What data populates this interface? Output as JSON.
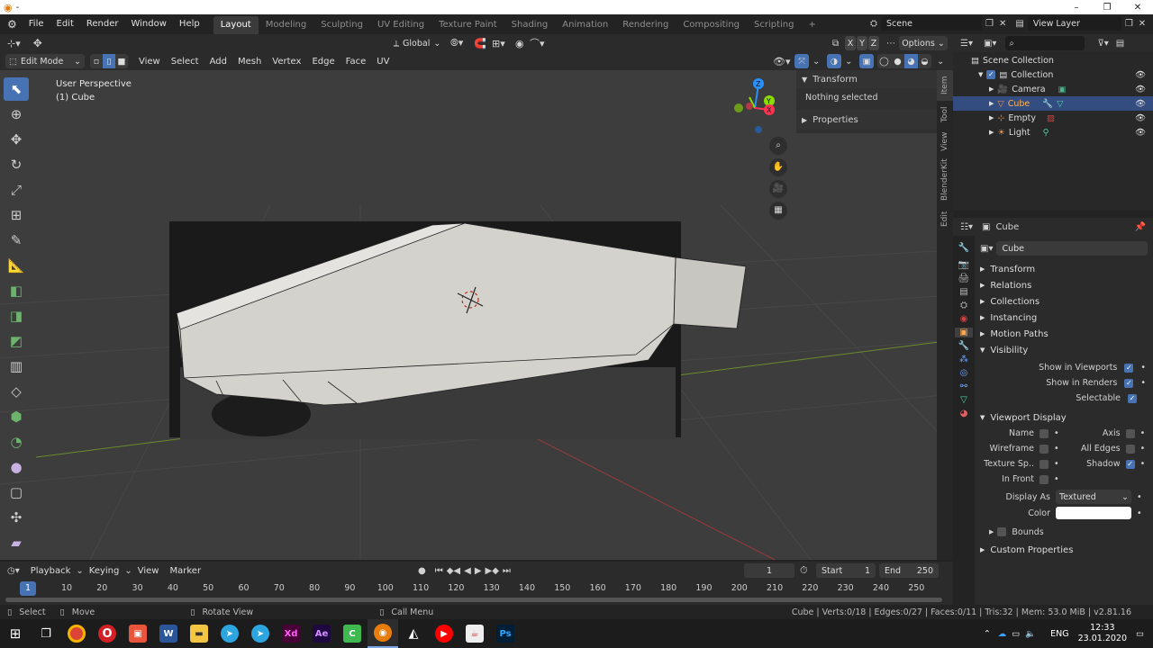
{
  "titlebar": {
    "title": "-",
    "min": "–",
    "max": "❐",
    "close": "✕"
  },
  "menu": {
    "items": [
      "File",
      "Edit",
      "Render",
      "Window",
      "Help"
    ]
  },
  "workspaces": {
    "tabs": [
      "Layout",
      "Modeling",
      "Sculpting",
      "UV Editing",
      "Texture Paint",
      "Shading",
      "Animation",
      "Rendering",
      "Compositing",
      "Scripting"
    ],
    "add": "+"
  },
  "scene": {
    "label": "Scene",
    "view_layer": "View Layer"
  },
  "viewport": {
    "transform_orientation": "Global",
    "options": "Options",
    "axis_x": "X",
    "axis_y": "Y",
    "axis_z": "Z",
    "mode": "Edit Mode",
    "header_menus": [
      "View",
      "Select",
      "Add",
      "Mesh",
      "Vertex",
      "Edge",
      "Face",
      "UV"
    ],
    "perspective": "User Perspective",
    "object": "(1) Cube",
    "gizmo": {
      "z": "Z",
      "y": "Y",
      "x": "X"
    }
  },
  "npanel": {
    "transform": "Transform",
    "nothing_selected": "Nothing selected",
    "properties": "Properties",
    "tabs": [
      "Item",
      "Tool",
      "View",
      "BlenderKit",
      "Edit"
    ]
  },
  "outliner": {
    "root": "Scene Collection",
    "collection": "Collection",
    "items": [
      "Camera",
      "Cube",
      "Empty",
      "Light"
    ]
  },
  "properties": {
    "object_name": "Cube",
    "field_name": "Cube",
    "sections": [
      "Transform",
      "Relations",
      "Collections",
      "Instancing",
      "Motion Paths"
    ],
    "visibility": {
      "title": "Visibility",
      "show_viewports": "Show in Viewports",
      "show_renders": "Show in Renders",
      "selectable": "Selectable"
    },
    "viewport_display": {
      "title": "Viewport Display",
      "name": "Name",
      "axis": "Axis",
      "wireframe": "Wireframe",
      "all_edges": "All Edges",
      "texture_space": "Texture Sp..",
      "shadow": "Shadow",
      "in_front": "In Front",
      "display_as_label": "Display As",
      "display_as_value": "Textured",
      "color_label": "Color",
      "bounds": "Bounds"
    },
    "custom_properties": "Custom Properties"
  },
  "timeline": {
    "menus": [
      "Playback",
      "Keying",
      "View",
      "Marker"
    ],
    "current_frame": "1",
    "start_label": "Start",
    "start": "1",
    "end_label": "End",
    "end": "250",
    "ruler": [
      "1",
      "10",
      "20",
      "30",
      "40",
      "50",
      "60",
      "70",
      "80",
      "90",
      "100",
      "110",
      "120",
      "130",
      "140",
      "150",
      "160",
      "170",
      "180",
      "190",
      "200",
      "210",
      "220",
      "230",
      "240",
      "250"
    ]
  },
  "statusbar": {
    "select": "Select",
    "move": "Move",
    "rotate": "Rotate View",
    "call_menu": "Call Menu",
    "stats": "Cube | Verts:0/18 | Edges:0/27 | Faces:0/11 | Tris:32 | Mem: 53.0 MiB | v2.81.16"
  },
  "taskbar": {
    "lang": "ENG",
    "time": "12:33",
    "date": "23.01.2020"
  },
  "colors": {
    "accent": "#4772b3",
    "x_axis": "#ff3352",
    "y_axis": "#8bdc00",
    "z_axis": "#2890ff"
  }
}
